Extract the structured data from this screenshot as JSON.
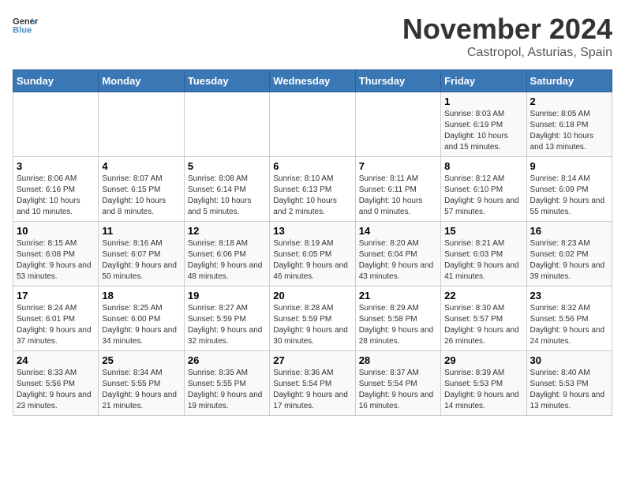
{
  "header": {
    "logo_line1": "General",
    "logo_line2": "Blue",
    "month": "November 2024",
    "location": "Castropol, Asturias, Spain"
  },
  "weekdays": [
    "Sunday",
    "Monday",
    "Tuesday",
    "Wednesday",
    "Thursday",
    "Friday",
    "Saturday"
  ],
  "weeks": [
    [
      {
        "day": "",
        "info": ""
      },
      {
        "day": "",
        "info": ""
      },
      {
        "day": "",
        "info": ""
      },
      {
        "day": "",
        "info": ""
      },
      {
        "day": "",
        "info": ""
      },
      {
        "day": "1",
        "info": "Sunrise: 8:03 AM\nSunset: 6:19 PM\nDaylight: 10 hours and 15 minutes."
      },
      {
        "day": "2",
        "info": "Sunrise: 8:05 AM\nSunset: 6:18 PM\nDaylight: 10 hours and 13 minutes."
      }
    ],
    [
      {
        "day": "3",
        "info": "Sunrise: 8:06 AM\nSunset: 6:16 PM\nDaylight: 10 hours and 10 minutes."
      },
      {
        "day": "4",
        "info": "Sunrise: 8:07 AM\nSunset: 6:15 PM\nDaylight: 10 hours and 8 minutes."
      },
      {
        "day": "5",
        "info": "Sunrise: 8:08 AM\nSunset: 6:14 PM\nDaylight: 10 hours and 5 minutes."
      },
      {
        "day": "6",
        "info": "Sunrise: 8:10 AM\nSunset: 6:13 PM\nDaylight: 10 hours and 2 minutes."
      },
      {
        "day": "7",
        "info": "Sunrise: 8:11 AM\nSunset: 6:11 PM\nDaylight: 10 hours and 0 minutes."
      },
      {
        "day": "8",
        "info": "Sunrise: 8:12 AM\nSunset: 6:10 PM\nDaylight: 9 hours and 57 minutes."
      },
      {
        "day": "9",
        "info": "Sunrise: 8:14 AM\nSunset: 6:09 PM\nDaylight: 9 hours and 55 minutes."
      }
    ],
    [
      {
        "day": "10",
        "info": "Sunrise: 8:15 AM\nSunset: 6:08 PM\nDaylight: 9 hours and 53 minutes."
      },
      {
        "day": "11",
        "info": "Sunrise: 8:16 AM\nSunset: 6:07 PM\nDaylight: 9 hours and 50 minutes."
      },
      {
        "day": "12",
        "info": "Sunrise: 8:18 AM\nSunset: 6:06 PM\nDaylight: 9 hours and 48 minutes."
      },
      {
        "day": "13",
        "info": "Sunrise: 8:19 AM\nSunset: 6:05 PM\nDaylight: 9 hours and 46 minutes."
      },
      {
        "day": "14",
        "info": "Sunrise: 8:20 AM\nSunset: 6:04 PM\nDaylight: 9 hours and 43 minutes."
      },
      {
        "day": "15",
        "info": "Sunrise: 8:21 AM\nSunset: 6:03 PM\nDaylight: 9 hours and 41 minutes."
      },
      {
        "day": "16",
        "info": "Sunrise: 8:23 AM\nSunset: 6:02 PM\nDaylight: 9 hours and 39 minutes."
      }
    ],
    [
      {
        "day": "17",
        "info": "Sunrise: 8:24 AM\nSunset: 6:01 PM\nDaylight: 9 hours and 37 minutes."
      },
      {
        "day": "18",
        "info": "Sunrise: 8:25 AM\nSunset: 6:00 PM\nDaylight: 9 hours and 34 minutes."
      },
      {
        "day": "19",
        "info": "Sunrise: 8:27 AM\nSunset: 5:59 PM\nDaylight: 9 hours and 32 minutes."
      },
      {
        "day": "20",
        "info": "Sunrise: 8:28 AM\nSunset: 5:59 PM\nDaylight: 9 hours and 30 minutes."
      },
      {
        "day": "21",
        "info": "Sunrise: 8:29 AM\nSunset: 5:58 PM\nDaylight: 9 hours and 28 minutes."
      },
      {
        "day": "22",
        "info": "Sunrise: 8:30 AM\nSunset: 5:57 PM\nDaylight: 9 hours and 26 minutes."
      },
      {
        "day": "23",
        "info": "Sunrise: 8:32 AM\nSunset: 5:56 PM\nDaylight: 9 hours and 24 minutes."
      }
    ],
    [
      {
        "day": "24",
        "info": "Sunrise: 8:33 AM\nSunset: 5:56 PM\nDaylight: 9 hours and 23 minutes."
      },
      {
        "day": "25",
        "info": "Sunrise: 8:34 AM\nSunset: 5:55 PM\nDaylight: 9 hours and 21 minutes."
      },
      {
        "day": "26",
        "info": "Sunrise: 8:35 AM\nSunset: 5:55 PM\nDaylight: 9 hours and 19 minutes."
      },
      {
        "day": "27",
        "info": "Sunrise: 8:36 AM\nSunset: 5:54 PM\nDaylight: 9 hours and 17 minutes."
      },
      {
        "day": "28",
        "info": "Sunrise: 8:37 AM\nSunset: 5:54 PM\nDaylight: 9 hours and 16 minutes."
      },
      {
        "day": "29",
        "info": "Sunrise: 8:39 AM\nSunset: 5:53 PM\nDaylight: 9 hours and 14 minutes."
      },
      {
        "day": "30",
        "info": "Sunrise: 8:40 AM\nSunset: 5:53 PM\nDaylight: 9 hours and 13 minutes."
      }
    ]
  ]
}
